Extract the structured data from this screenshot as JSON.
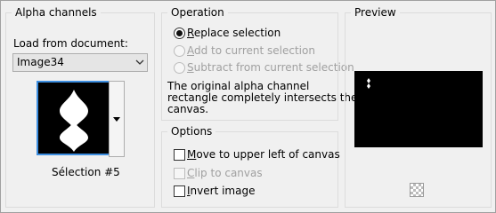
{
  "alpha": {
    "title": "Alpha channels",
    "load_label": "Load from document:",
    "document": "Image34",
    "selection_name": "Sélection #5"
  },
  "operation": {
    "title": "Operation",
    "options": [
      {
        "label": "Replace selection",
        "checked": true,
        "enabled": true
      },
      {
        "label": "Add to current selection",
        "checked": false,
        "enabled": false
      },
      {
        "label": "Subtract from current selection",
        "checked": false,
        "enabled": false
      }
    ],
    "info_line1": "The original alpha channel",
    "info_line2": "rectangle completely intersects the",
    "info_line3": "canvas."
  },
  "options": {
    "title": "Options",
    "items": [
      {
        "label": "Move to upper left of canvas",
        "checked": false,
        "enabled": true
      },
      {
        "label": "Clip to canvas",
        "checked": false,
        "enabled": false
      },
      {
        "label": "Invert image",
        "checked": false,
        "enabled": true
      }
    ]
  },
  "preview": {
    "title": "Preview"
  }
}
